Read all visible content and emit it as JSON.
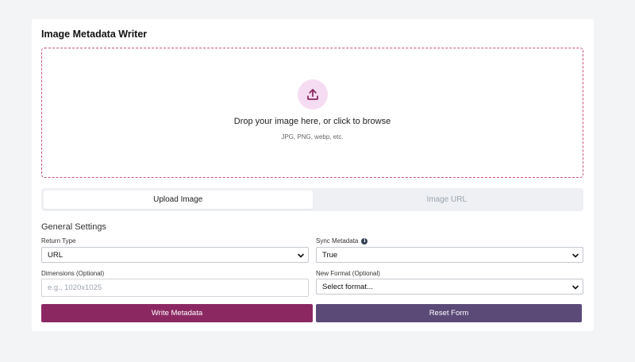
{
  "header": {
    "title": "Image Metadata Writer"
  },
  "dropzone": {
    "icon": "upload-icon",
    "text": "Drop your image here, or click to browse",
    "subtext": "JPG, PNG, webp, etc."
  },
  "tabs": [
    {
      "label": "Upload Image",
      "active": true
    },
    {
      "label": "Image URL",
      "active": false
    }
  ],
  "settings": {
    "title": "General Settings",
    "return_type": {
      "label": "Return Type",
      "value": "URL"
    },
    "sync_metadata": {
      "label": "Sync Metadata",
      "value": "True",
      "icon": "info-icon"
    },
    "dimensions": {
      "label": "Dimensions (Optional)",
      "placeholder": "e.g., 1020x1025"
    },
    "new_format": {
      "label": "New Format (Optional)",
      "value": "Select format..."
    }
  },
  "actions": {
    "write_label": "Write Metadata",
    "reset_label": "Reset Form"
  },
  "colors": {
    "primary": "#8b2862",
    "secondary": "#5b4a78",
    "dropzone_border": "#c8557a",
    "icon_bg": "#f6dcf2"
  }
}
